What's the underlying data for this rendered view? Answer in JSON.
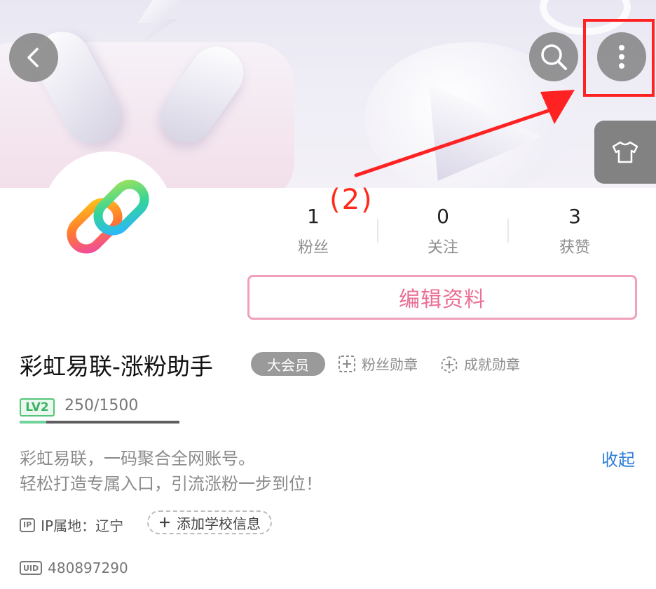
{
  "header": {
    "back_icon": "chevron-left-icon",
    "search_icon": "search-icon",
    "more_icon": "more-vertical-icon",
    "skin_icon": "tshirt-icon"
  },
  "annotation": {
    "step_label": "(2)",
    "color": "#ff2222"
  },
  "profile": {
    "avatar_icon": "rainbow-link-logo",
    "stats": [
      {
        "value": "1",
        "label": "粉丝"
      },
      {
        "value": "0",
        "label": "关注"
      },
      {
        "value": "3",
        "label": "获赞"
      }
    ],
    "edit_label": "编辑资料",
    "name": "彩虹易联-涨粉助手",
    "vip_label": "大会员",
    "fan_medal_label": "粉丝勋章",
    "achievement_medal_label": "成就勋章",
    "level": {
      "badge": "LV2",
      "progress_text": "250/1500",
      "progress_fraction": 0.167
    },
    "bio_line1": "彩虹易联，一码聚合全网账号。",
    "bio_line2": "轻松打造专属入口，引流涨粉一步到位！",
    "collapse_label": "收起",
    "ip_badge": "IP",
    "ip_label": "IP属地：辽宁",
    "add_school_label": "添加学校信息",
    "uid_badge": "UID",
    "uid": "480897290"
  },
  "colors": {
    "accent_pink": "#ea6f95",
    "link_blue": "#2f7fd9",
    "level_green": "#55c57a"
  }
}
